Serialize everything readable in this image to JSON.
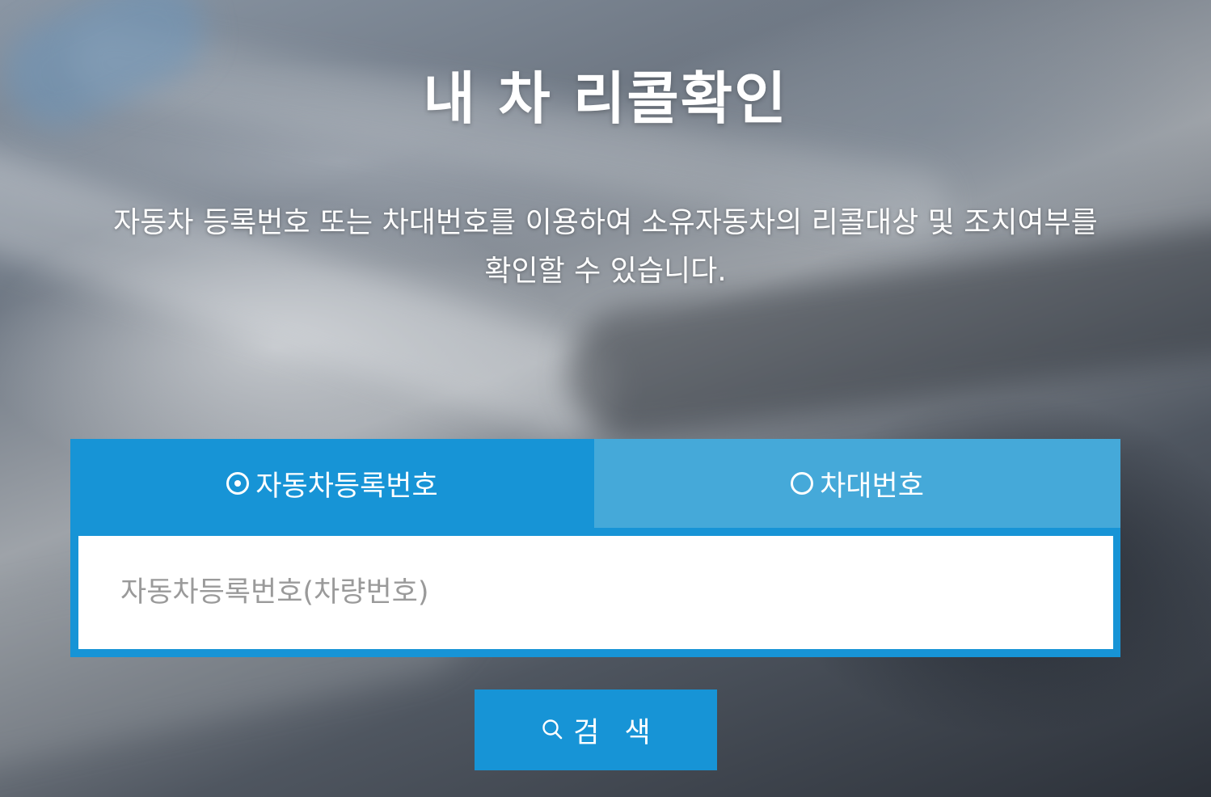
{
  "page": {
    "title": "내 차 리콜확인",
    "description_line1": "자동차 등록번호 또는 차대번호를 이용하여 소유자동차의 리콜대상 및 조치여부를",
    "description_line2": "확인할 수 있습니다."
  },
  "tabs": [
    {
      "label": "자동차등록번호",
      "selected": true
    },
    {
      "label": "차대번호",
      "selected": false
    }
  ],
  "search": {
    "value": "",
    "placeholder": "자동차등록번호(차량번호)",
    "button_label": "검 색"
  },
  "colors": {
    "accent": "#1794d6",
    "tab_inactive": "#45a9d9",
    "placeholder": "#9a9a9a"
  },
  "icons": {
    "selected_tab": "radio-checked-icon",
    "unselected_tab": "radio-unchecked-icon",
    "search": "search-icon"
  }
}
